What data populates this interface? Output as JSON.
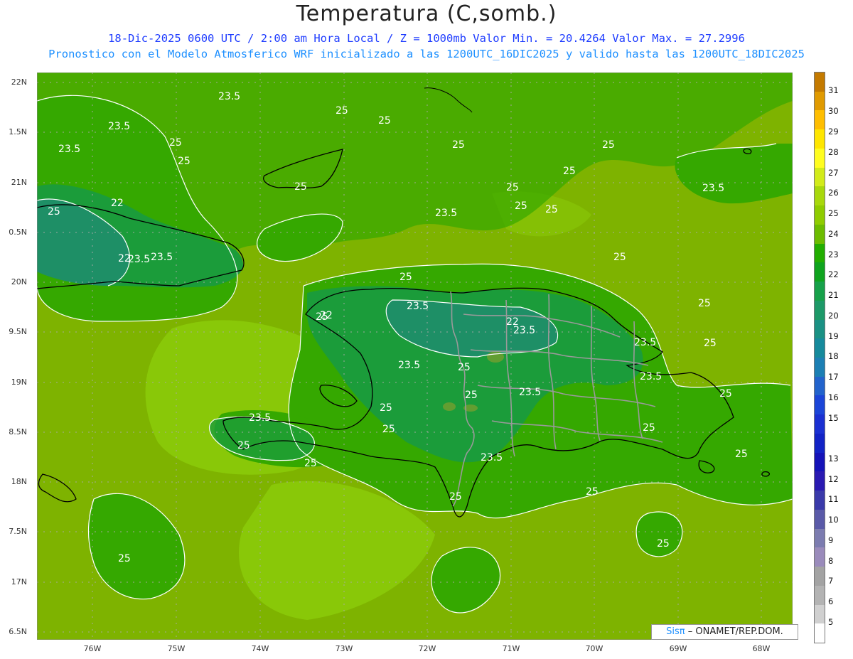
{
  "header": {
    "title": "Temperatura (C,somb.)",
    "subtitle_line1": "18-Dic-2025  0600 UTC / 2:00 am Hora Local / Z = 1000mb    Valor Min. = 20.4264  Valor Max. = 27.2996",
    "subtitle_line2": "Pronostico con el Modelo Atmosferico WRF inicializado a las 1200UTC_16DIC2025 y valido hasta las  1200UTC_18DIC2025"
  },
  "axes": {
    "lat_labels": [
      "22N",
      "1.5N",
      "21N",
      "0.5N",
      "20N",
      "9.5N",
      "19N",
      "8.5N",
      "18N",
      "7.5N",
      "17N",
      "6.5N"
    ],
    "lon_labels": [
      "76W",
      "75W",
      "74W",
      "73W",
      "72W",
      "71W",
      "70W",
      "69W",
      "68W"
    ]
  },
  "contour_labels": [
    "23.5",
    "25",
    "23.5",
    "25",
    "23.5",
    "25",
    "25",
    "25",
    "25",
    "25",
    "25",
    "25",
    "25",
    "23.5",
    "23.5",
    "22",
    "25",
    "25",
    "22",
    "23.5",
    "23.5",
    "25",
    "25",
    "25",
    "25",
    "23.5",
    "25",
    "22",
    "22",
    "23.5",
    "23.5",
    "25",
    "25",
    "23.5",
    "23.5",
    "23.5",
    "25",
    "25",
    "25",
    "23.5",
    "25",
    "25",
    "25",
    "23.5",
    "25",
    "25",
    "25",
    "25",
    "25"
  ],
  "colorbar": {
    "labels": [
      "31",
      "30",
      "29",
      "28",
      "27",
      "26",
      "25",
      "24",
      "23",
      "22",
      "21",
      "20",
      "19",
      "18",
      "17",
      "16",
      "15",
      "13",
      "12",
      "11",
      "10",
      "9",
      "8",
      "7",
      "6",
      "5"
    ],
    "colors": [
      "#c47a00",
      "#e09a00",
      "#ffbe00",
      "#ffe600",
      "#fffd20",
      "#d2eb1a",
      "#a8d80c",
      "#8fcc00",
      "#6cbc00",
      "#22ae00",
      "#0fa41e",
      "#17a14a",
      "#1d9968",
      "#1a9184",
      "#168a9c",
      "#1c7fb4",
      "#2263cc",
      "#1b45d8",
      "#1a30d2",
      "#1223c6",
      "#1513b8",
      "#2a1ab2",
      "#3a3aaa",
      "#5a5aa8",
      "#7c7cb0",
      "#9a8bbb",
      "#a3a3a3",
      "#b3b3b3",
      "#d0d0d0",
      "#ffffff"
    ]
  },
  "credit": {
    "logo": "Sisπ",
    "text": "– ONAMET/REP.DOM."
  },
  "field_colors": {
    "sea": "#7eb300",
    "warm_sea": "#8ccd0a",
    "mid": "#35a800",
    "land": "#1b9c3a",
    "cool": "#1e8f66",
    "highland": "#6f9f30",
    "isoline": "#ffffff",
    "coast": "#000000",
    "border": "#9a9a9a",
    "grid": "#aaaaaa"
  }
}
